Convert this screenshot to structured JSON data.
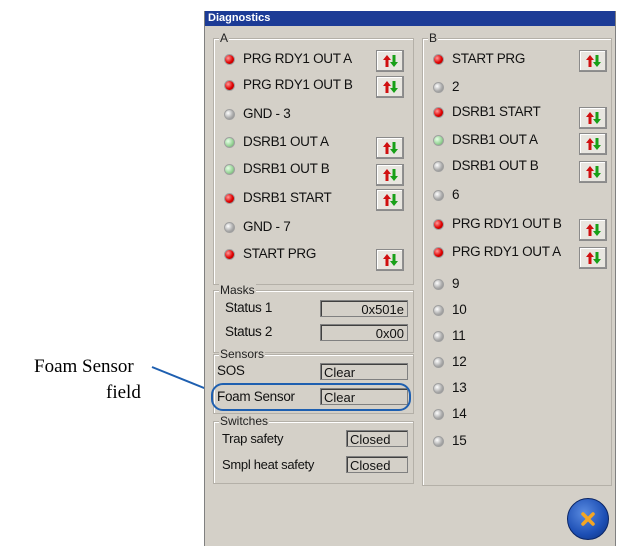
{
  "window": {
    "title": "Diagnostics"
  },
  "group_a": {
    "label": "A",
    "items": [
      {
        "led": "red",
        "label": "PRG RDY1 OUT A",
        "toggle": true
      },
      {
        "led": "red",
        "label": "PRG RDY1 OUT B",
        "toggle": true
      },
      {
        "led": "grey",
        "label": "GND - 3",
        "toggle": false
      },
      {
        "led": "green",
        "label": "DSRB1 OUT A",
        "toggle": true
      },
      {
        "led": "green",
        "label": "DSRB1 OUT B",
        "toggle": true
      },
      {
        "led": "red",
        "label": "DSRB1 START",
        "toggle": true
      },
      {
        "led": "grey",
        "label": "GND - 7",
        "toggle": false
      },
      {
        "led": "red",
        "label": "START PRG",
        "toggle": true
      }
    ]
  },
  "group_b": {
    "label": "B",
    "items": [
      {
        "led": "red",
        "label": "START PRG",
        "toggle": true
      },
      {
        "led": "grey",
        "label": "2",
        "toggle": false
      },
      {
        "led": "red",
        "label": "DSRB1 START",
        "toggle": true
      },
      {
        "led": "green",
        "label": "DSRB1 OUT A",
        "toggle": true
      },
      {
        "led": "grey",
        "label": "DSRB1 OUT B",
        "toggle": true
      },
      {
        "led": "grey",
        "label": "6",
        "toggle": false
      },
      {
        "led": "red",
        "label": "PRG RDY1 OUT B",
        "toggle": true
      },
      {
        "led": "red",
        "label": "PRG RDY1 OUT A",
        "toggle": true
      },
      {
        "led": "grey",
        "label": "9",
        "toggle": false
      },
      {
        "led": "grey",
        "label": "10",
        "toggle": false
      },
      {
        "led": "grey",
        "label": "11",
        "toggle": false
      },
      {
        "led": "grey",
        "label": "12",
        "toggle": false
      },
      {
        "led": "grey",
        "label": "13",
        "toggle": false
      },
      {
        "led": "grey",
        "label": "14",
        "toggle": false
      },
      {
        "led": "grey",
        "label": "15",
        "toggle": false
      }
    ]
  },
  "masks": {
    "label": "Masks",
    "status1_label": "Status 1",
    "status1_value": "0x501e",
    "status2_label": "Status 2",
    "status2_value": "0x00"
  },
  "sensors": {
    "label": "Sensors",
    "sos_label": "SOS",
    "sos_value": "Clear",
    "foam_label": "Foam Sensor",
    "foam_value": "Clear"
  },
  "switches": {
    "label": "Switches",
    "trap_label": "Trap safety",
    "trap_value": "Closed",
    "smpl_label": "Smpl heat safety",
    "smpl_value": "Closed"
  },
  "annotation": {
    "line1": "Foam Sensor",
    "line2": "field"
  },
  "colors": {
    "titlebar": "#1c3b96",
    "callout": "#1e5fb0",
    "led_red": "#e00000"
  },
  "icons": {
    "toggle": "up-down-arrows-icon",
    "close": "close-x-icon"
  }
}
